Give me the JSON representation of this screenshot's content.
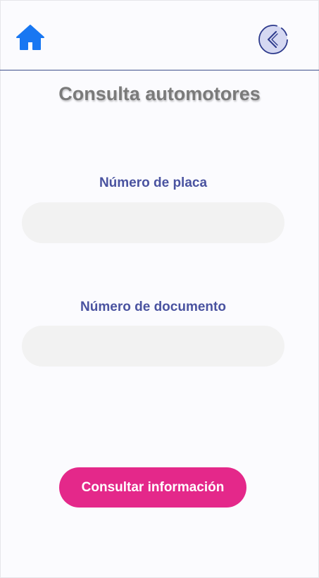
{
  "header": {
    "home_icon": "home-icon",
    "back_icon": "chevron-left-icon"
  },
  "title": "Consulta automotores",
  "form": {
    "plate_label": "Número de placa",
    "plate_value": "",
    "document_label": "Número de documento",
    "document_value": "",
    "submit_label": "Consultar información"
  },
  "colors": {
    "accent_blue": "#1877f2",
    "label_color": "#4a53a0",
    "button_pink": "#e4288a",
    "divider": "#3d4f8c"
  }
}
